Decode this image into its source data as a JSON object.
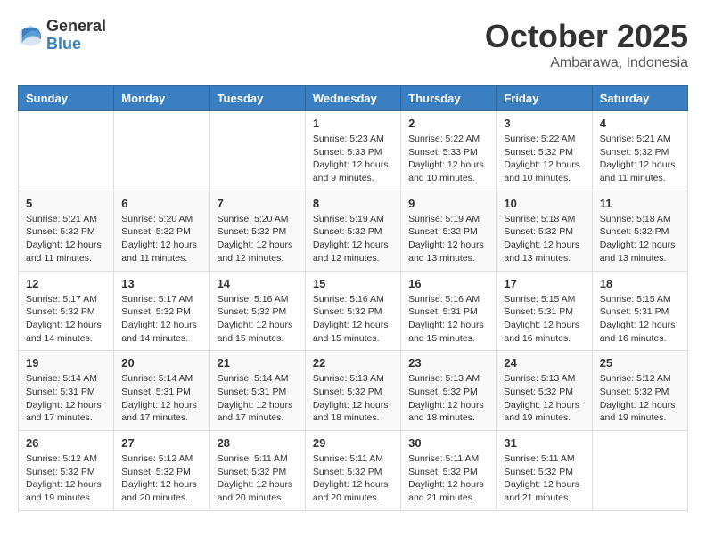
{
  "header": {
    "logo_general": "General",
    "logo_blue": "Blue",
    "month": "October 2025",
    "location": "Ambarawa, Indonesia"
  },
  "days_of_week": [
    "Sunday",
    "Monday",
    "Tuesday",
    "Wednesday",
    "Thursday",
    "Friday",
    "Saturday"
  ],
  "weeks": [
    [
      {
        "day": "",
        "info": ""
      },
      {
        "day": "",
        "info": ""
      },
      {
        "day": "",
        "info": ""
      },
      {
        "day": "1",
        "info": "Sunrise: 5:23 AM\nSunset: 5:33 PM\nDaylight: 12 hours and 9 minutes."
      },
      {
        "day": "2",
        "info": "Sunrise: 5:22 AM\nSunset: 5:33 PM\nDaylight: 12 hours and 10 minutes."
      },
      {
        "day": "3",
        "info": "Sunrise: 5:22 AM\nSunset: 5:32 PM\nDaylight: 12 hours and 10 minutes."
      },
      {
        "day": "4",
        "info": "Sunrise: 5:21 AM\nSunset: 5:32 PM\nDaylight: 12 hours and 11 minutes."
      }
    ],
    [
      {
        "day": "5",
        "info": "Sunrise: 5:21 AM\nSunset: 5:32 PM\nDaylight: 12 hours and 11 minutes."
      },
      {
        "day": "6",
        "info": "Sunrise: 5:20 AM\nSunset: 5:32 PM\nDaylight: 12 hours and 11 minutes."
      },
      {
        "day": "7",
        "info": "Sunrise: 5:20 AM\nSunset: 5:32 PM\nDaylight: 12 hours and 12 minutes."
      },
      {
        "day": "8",
        "info": "Sunrise: 5:19 AM\nSunset: 5:32 PM\nDaylight: 12 hours and 12 minutes."
      },
      {
        "day": "9",
        "info": "Sunrise: 5:19 AM\nSunset: 5:32 PM\nDaylight: 12 hours and 13 minutes."
      },
      {
        "day": "10",
        "info": "Sunrise: 5:18 AM\nSunset: 5:32 PM\nDaylight: 12 hours and 13 minutes."
      },
      {
        "day": "11",
        "info": "Sunrise: 5:18 AM\nSunset: 5:32 PM\nDaylight: 12 hours and 13 minutes."
      }
    ],
    [
      {
        "day": "12",
        "info": "Sunrise: 5:17 AM\nSunset: 5:32 PM\nDaylight: 12 hours and 14 minutes."
      },
      {
        "day": "13",
        "info": "Sunrise: 5:17 AM\nSunset: 5:32 PM\nDaylight: 12 hours and 14 minutes."
      },
      {
        "day": "14",
        "info": "Sunrise: 5:16 AM\nSunset: 5:32 PM\nDaylight: 12 hours and 15 minutes."
      },
      {
        "day": "15",
        "info": "Sunrise: 5:16 AM\nSunset: 5:32 PM\nDaylight: 12 hours and 15 minutes."
      },
      {
        "day": "16",
        "info": "Sunrise: 5:16 AM\nSunset: 5:31 PM\nDaylight: 12 hours and 15 minutes."
      },
      {
        "day": "17",
        "info": "Sunrise: 5:15 AM\nSunset: 5:31 PM\nDaylight: 12 hours and 16 minutes."
      },
      {
        "day": "18",
        "info": "Sunrise: 5:15 AM\nSunset: 5:31 PM\nDaylight: 12 hours and 16 minutes."
      }
    ],
    [
      {
        "day": "19",
        "info": "Sunrise: 5:14 AM\nSunset: 5:31 PM\nDaylight: 12 hours and 17 minutes."
      },
      {
        "day": "20",
        "info": "Sunrise: 5:14 AM\nSunset: 5:31 PM\nDaylight: 12 hours and 17 minutes."
      },
      {
        "day": "21",
        "info": "Sunrise: 5:14 AM\nSunset: 5:31 PM\nDaylight: 12 hours and 17 minutes."
      },
      {
        "day": "22",
        "info": "Sunrise: 5:13 AM\nSunset: 5:32 PM\nDaylight: 12 hours and 18 minutes."
      },
      {
        "day": "23",
        "info": "Sunrise: 5:13 AM\nSunset: 5:32 PM\nDaylight: 12 hours and 18 minutes."
      },
      {
        "day": "24",
        "info": "Sunrise: 5:13 AM\nSunset: 5:32 PM\nDaylight: 12 hours and 19 minutes."
      },
      {
        "day": "25",
        "info": "Sunrise: 5:12 AM\nSunset: 5:32 PM\nDaylight: 12 hours and 19 minutes."
      }
    ],
    [
      {
        "day": "26",
        "info": "Sunrise: 5:12 AM\nSunset: 5:32 PM\nDaylight: 12 hours and 19 minutes."
      },
      {
        "day": "27",
        "info": "Sunrise: 5:12 AM\nSunset: 5:32 PM\nDaylight: 12 hours and 20 minutes."
      },
      {
        "day": "28",
        "info": "Sunrise: 5:11 AM\nSunset: 5:32 PM\nDaylight: 12 hours and 20 minutes."
      },
      {
        "day": "29",
        "info": "Sunrise: 5:11 AM\nSunset: 5:32 PM\nDaylight: 12 hours and 20 minutes."
      },
      {
        "day": "30",
        "info": "Sunrise: 5:11 AM\nSunset: 5:32 PM\nDaylight: 12 hours and 21 minutes."
      },
      {
        "day": "31",
        "info": "Sunrise: 5:11 AM\nSunset: 5:32 PM\nDaylight: 12 hours and 21 minutes."
      },
      {
        "day": "",
        "info": ""
      }
    ]
  ]
}
